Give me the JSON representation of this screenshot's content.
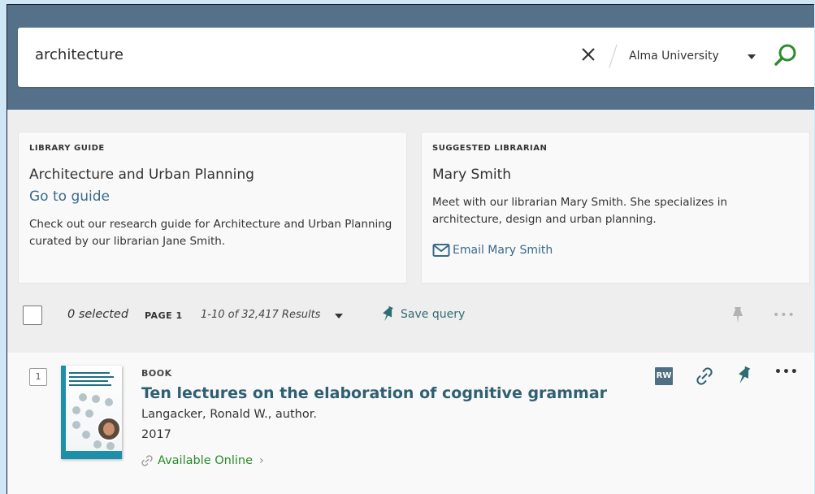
{
  "search": {
    "query": "architecture",
    "scope": "Alma University"
  },
  "library_guide": {
    "kicker": "LIBRARY GUIDE",
    "title": "Architecture and Urban Planning",
    "link": "Go to guide",
    "description": "Check out our research guide for Architecture and Urban Planning curated by our librarian Jane Smith."
  },
  "librarian": {
    "kicker": "SUGGESTED LIBRARIAN",
    "name": "Mary Smith",
    "description": "Meet with our librarian Mary Smith. She specializes in architecture, design and urban planning.",
    "email_link": "Email Mary Smith"
  },
  "toolbar": {
    "selected": "0 selected",
    "page": "PAGE 1",
    "results": "1-10 of 32,417 Results",
    "save_query": "Save query",
    "more": "•••"
  },
  "result": {
    "number": "1",
    "type": "BOOK",
    "title": "Ten lectures on the elaboration of cognitive grammar",
    "author": "Langacker, Ronald W., author.",
    "year": "2017",
    "availability": "Available Online",
    "badge": "RW",
    "more": "•••"
  },
  "colors": {
    "header": "#55718a",
    "link": "#3a6a8c",
    "available": "#2a8a2a",
    "accent_teal": "#2f6c74"
  }
}
